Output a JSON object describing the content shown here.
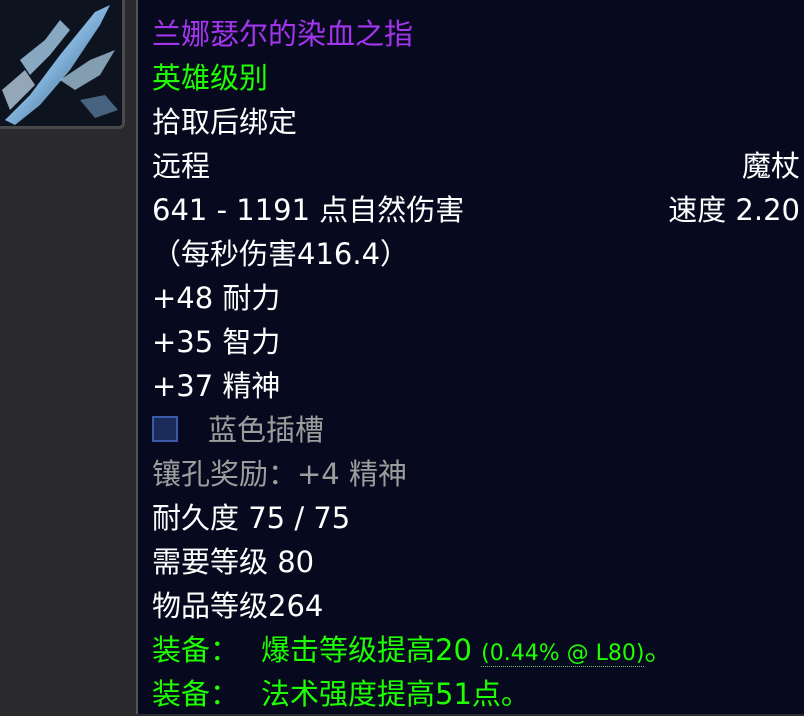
{
  "item": {
    "name": "兰娜瑟尔的染血之指",
    "quality": "英雄级别",
    "bind": "拾取后绑定",
    "slot": "远程",
    "type": "魔杖",
    "damage": "641 - 1191 点自然伤害",
    "speed": "速度 2.20",
    "dps": "（每秒伤害416.4）",
    "stats": [
      "+48 耐力",
      "+35 智力",
      "+37 精神"
    ],
    "socket": "蓝色插槽",
    "socket_bonus": "镶孔奖励：+4 精神",
    "durability": "耐久度 75 / 75",
    "req_level": "需要等级 80",
    "item_level": "物品等级264",
    "equip1_label": "装备：",
    "equip1_text": "爆击等级提高20",
    "equip1_extra": "(0.44% @ L80)",
    "equip1_end": "。",
    "equip2_label": "装备：",
    "equip2_text": "法术强度提高51点。"
  },
  "colors": {
    "epic": "#a335ee",
    "uncommon": "#1eff00",
    "grey": "#9d9d9d",
    "bg": "#070a1f"
  }
}
